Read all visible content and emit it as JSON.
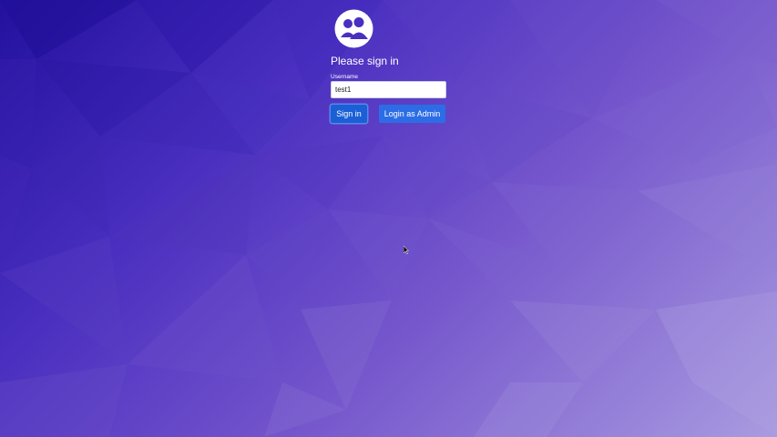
{
  "page": {
    "heading": "Please sign in"
  },
  "form": {
    "username_label": "Username",
    "username_value": "test1"
  },
  "buttons": {
    "sign_in": "Sign in",
    "login_as_admin": "Login as Admin"
  },
  "icons": {
    "logo": "users-circle-icon",
    "cursor": "mouse-pointer-icon"
  },
  "colors": {
    "background_dark": "#23119e",
    "background_light": "#a99be0",
    "primary_button": "#1a5fd6",
    "secondary_button": "#2c6de6"
  }
}
